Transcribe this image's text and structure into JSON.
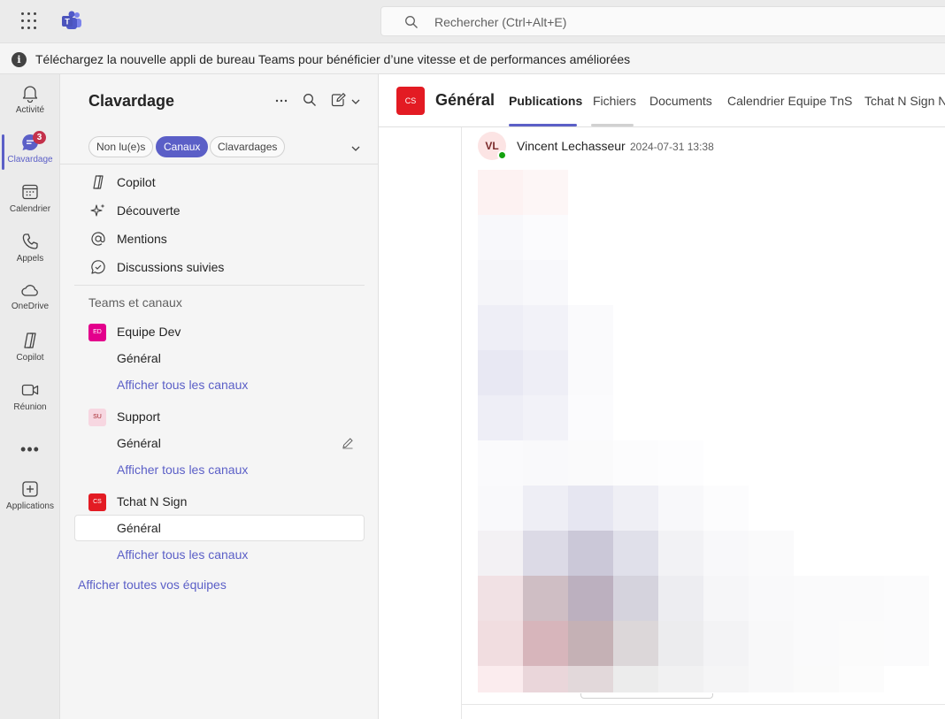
{
  "topbar": {
    "app_launcher_icon": "waffle-icon",
    "app_logo_icon": "teams-logo-icon",
    "search_placeholder": "Rechercher (Ctrl+Alt+E)"
  },
  "banner": {
    "icon": "info-icon",
    "text": "Téléchargez la nouvelle appli de bureau Teams pour bénéficier d’une vitesse et de performances améliorées"
  },
  "rail": {
    "items": [
      {
        "label": "Activité",
        "icon": "bell-icon"
      },
      {
        "label": "Clavardage",
        "icon": "chat-icon",
        "badge": "3",
        "active": true
      },
      {
        "label": "Calendrier",
        "icon": "calendar-icon"
      },
      {
        "label": "Appels",
        "icon": "phone-icon"
      },
      {
        "label": "OneDrive",
        "icon": "cloud-icon"
      },
      {
        "label": "Copilot",
        "icon": "copilot-icon"
      },
      {
        "label": "Réunion",
        "icon": "video-icon"
      },
      {
        "label": "Applications",
        "icon": "add-app-icon"
      }
    ],
    "more_label": "•••"
  },
  "pane": {
    "title": "Clavardage",
    "filters": [
      "Non lu(e)s",
      "Canaux",
      "Clavardages"
    ],
    "active_filter": "Canaux",
    "nav": [
      {
        "label": "Copilot",
        "icon": "copilot-icon"
      },
      {
        "label": "Découverte",
        "icon": "sparkle-icon"
      },
      {
        "label": "Mentions",
        "icon": "at-icon"
      },
      {
        "label": "Discussions suivies",
        "icon": "followed-chat-icon"
      }
    ],
    "section_label": "Teams et canaux",
    "teams": [
      {
        "name": "Equipe Dev",
        "initials": "ED",
        "color": "#e3008c",
        "channel": "Général",
        "show_all": "Afficher tous les canaux"
      },
      {
        "name": "Support",
        "initials": "SU",
        "color": "#f7d7e1",
        "channel": "Général",
        "show_all": "Afficher tous les canaux"
      },
      {
        "name": "Tchat N Sign",
        "initials": "CS",
        "color": "#e31b23",
        "channel": "Général",
        "show_all": "Afficher tous les canaux"
      }
    ],
    "all_teams_link": "Afficher toutes vos équipes"
  },
  "channel": {
    "avatar_initials": "CS",
    "avatar_color": "#e31b23",
    "name": "Général",
    "tabs": [
      "Publications",
      "Fichiers",
      "Documents",
      "Calendrier Equipe TnS",
      "Tchat N Sign N"
    ],
    "active_tab": "Publications"
  },
  "message": {
    "avatar_initials": "VL",
    "author": "Vincent Lechasseur",
    "timestamp": "2024-07-31 13:38",
    "presence": "available"
  },
  "colors": {
    "accent": "#5b5fc7",
    "presence_green": "#13a10e",
    "badge_red": "#c4314b"
  }
}
